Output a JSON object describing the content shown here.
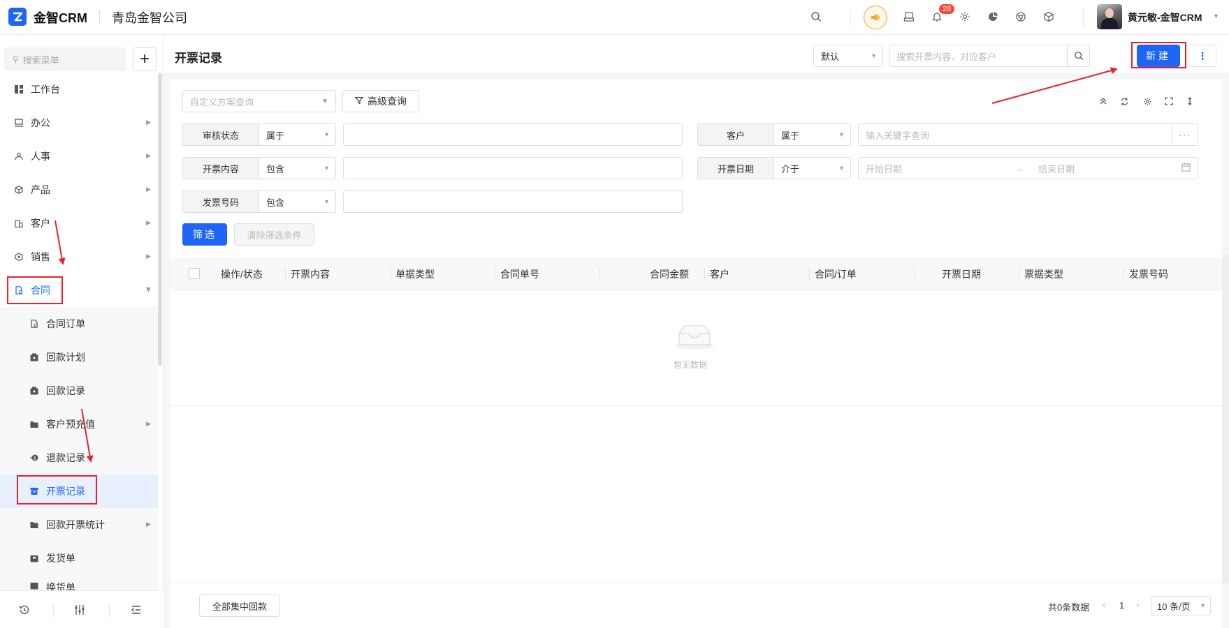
{
  "app": {
    "name": "金智CRM",
    "company": "青岛金智公司"
  },
  "topbar": {
    "notification_count": "28",
    "user_name": "黄元敏-金智CRM",
    "icons": [
      "search-icon",
      "megaphone-icon",
      "inbox-icon",
      "bell-icon",
      "gear-icon",
      "pie-chart-icon",
      "chrome-icon",
      "cube-icon"
    ]
  },
  "sidebar": {
    "search_placeholder": "搜索菜单",
    "add_label": "+",
    "items": [
      {
        "label": "工作台",
        "icon": "dashboard-icon"
      },
      {
        "label": "办公",
        "icon": "monitor-icon"
      },
      {
        "label": "人事",
        "icon": "people-icon"
      },
      {
        "label": "产品",
        "icon": "box-icon"
      },
      {
        "label": "客户",
        "icon": "building-icon"
      },
      {
        "label": "销售",
        "icon": "hexagon-icon"
      },
      {
        "label": "合同",
        "icon": "contract-icon"
      }
    ],
    "sub_items": [
      {
        "label": "合同订单",
        "icon": "document-icon"
      },
      {
        "label": "回款计划",
        "icon": "wallet-icon"
      },
      {
        "label": "回款记录",
        "icon": "wallet-icon"
      },
      {
        "label": "客户预充值",
        "icon": "folder-icon"
      },
      {
        "label": "退款记录",
        "icon": "refund-icon"
      },
      {
        "label": "开票记录",
        "icon": "invoice-icon"
      },
      {
        "label": "回款开票统计",
        "icon": "folder-icon"
      },
      {
        "label": "发货单",
        "icon": "package-icon"
      },
      {
        "label": "换货单",
        "icon": "package-icon"
      }
    ]
  },
  "main": {
    "title": "开票记录",
    "scheme_default": "默认",
    "search_placeholder": "搜索开票内容、对应客户",
    "new_label": "新建",
    "custom_query_placeholder": "自定义方案查询",
    "advanced_query_label": "高级查询",
    "filters": {
      "audit_label": "审核状态",
      "audit_op": "属于",
      "customer_label": "客户",
      "customer_op": "属于",
      "customer_placeholder": "输入关键字查询",
      "content_label": "开票内容",
      "content_op": "包含",
      "date_label": "开票日期",
      "date_op": "介于",
      "date_start": "开始日期",
      "date_end": "结束日期",
      "invoice_no_label": "发票号码",
      "invoice_no_op": "包含"
    },
    "filter_button": "筛选",
    "clear_button": "清除筛选条件",
    "columns": [
      "操作/状态",
      "开票内容",
      "单据类型",
      "合同单号",
      "合同金额",
      "客户",
      "合同/订单",
      "开票日期",
      "票据类型",
      "发票号码"
    ],
    "empty_text": "暂无数据",
    "collect_button": "全部集中回款",
    "total_text": "共0条数据",
    "current_page": "1",
    "page_size": "10 条/页"
  },
  "colors": {
    "primary": "#1f66f6",
    "annotation_red": "#e8212b",
    "badge": "#f5483b"
  }
}
